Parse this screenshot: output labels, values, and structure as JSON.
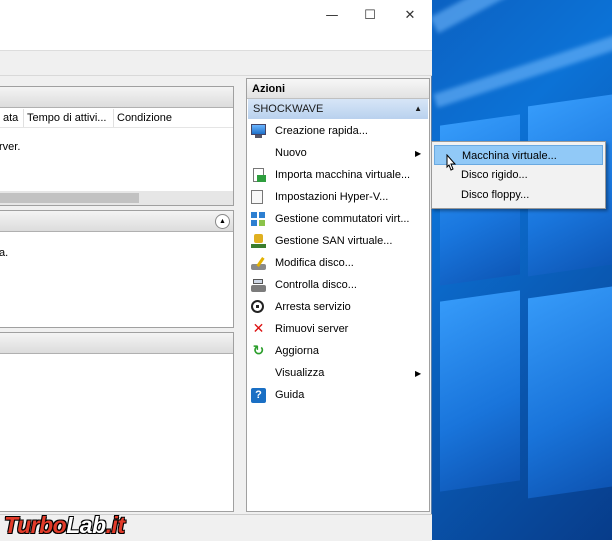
{
  "window": {
    "controls": {
      "minimize": "—",
      "maximize": "☐",
      "close": "✕"
    }
  },
  "virtual_machines_panel": {
    "columns": [
      "ata",
      "Tempo di attivi...",
      "Condizione"
    ],
    "message": "rver."
  },
  "checkpoints_panel": {
    "message": "a."
  },
  "actions": {
    "title": "Azioni",
    "group": "SHOCKWAVE",
    "items": [
      {
        "label": "Creazione rapida...",
        "icon": "monitor-icon",
        "submenu": false
      },
      {
        "label": "Nuovo",
        "icon": "",
        "submenu": true
      },
      {
        "label": "Importa macchina virtuale...",
        "icon": "import-icon",
        "submenu": false
      },
      {
        "label": "Impostazioni Hyper-V...",
        "icon": "settings-doc-icon",
        "submenu": false
      },
      {
        "label": "Gestione commutatori virt...",
        "icon": "switch-icon",
        "submenu": false
      },
      {
        "label": "Gestione SAN virtuale...",
        "icon": "san-icon",
        "submenu": false
      },
      {
        "label": "Modifica disco...",
        "icon": "edit-disk-icon",
        "submenu": false
      },
      {
        "label": "Controlla disco...",
        "icon": "inspect-disk-icon",
        "submenu": false
      },
      {
        "label": "Arresta servizio",
        "icon": "stop-icon",
        "submenu": false
      },
      {
        "label": "Rimuovi server",
        "icon": "remove-icon",
        "submenu": false
      },
      {
        "label": "Aggiorna",
        "icon": "refresh-icon",
        "submenu": false
      },
      {
        "label": "Visualizza",
        "icon": "",
        "submenu": true
      },
      {
        "label": "Guida",
        "icon": "help-icon",
        "submenu": false
      }
    ]
  },
  "submenu": {
    "items": [
      {
        "label": "Macchina virtuale...",
        "highlighted": true
      },
      {
        "label": "Disco rigido...",
        "highlighted": false
      },
      {
        "label": "Disco floppy...",
        "highlighted": false
      }
    ]
  },
  "watermark": {
    "part1": "Turbo",
    "part2": "Lab",
    "part3": ".it"
  },
  "colors": {
    "highlight": "#91c9f7",
    "group_header": "#b9d1ee",
    "remove_red": "#d11",
    "refresh_green": "#2a9d2a"
  }
}
